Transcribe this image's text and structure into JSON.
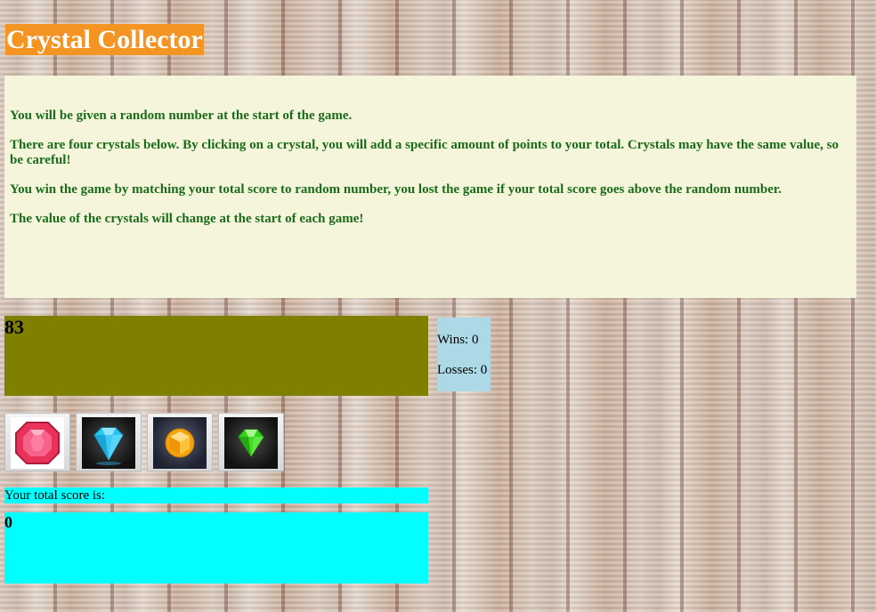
{
  "title": "Crystal Collector",
  "instructions": [
    "You will be given a random number at the start of the game.",
    "There are four crystals below. By clicking on a crystal, you will add a specific amount of points to your total. Crystals may have the same value, so be careful!",
    "You win the game by matching your total score to random number, you lost the game if your total score goes above the random number.",
    "The value of the crystals will change at the start of each game!"
  ],
  "target_number": "83",
  "record": {
    "wins": "Wins: 0",
    "losses": "Losses: 0"
  },
  "crystals": [
    {
      "icon": "red-crystal-icon",
      "color": "#e8325a"
    },
    {
      "icon": "blue-crystal-icon",
      "color": "#29c6f0"
    },
    {
      "icon": "orange-crystal-icon",
      "color": "#f5a20f"
    },
    {
      "icon": "green-crystal-icon",
      "color": "#33d11c"
    }
  ],
  "score_label": "Your total score is:",
  "total_score": "0",
  "colors": {
    "title_bg": "#f39423",
    "instructions_bg": "#f5f5dc",
    "instructions_text": "#1a6b1a",
    "target_bg": "#808000",
    "record_bg": "#add8e6",
    "score_bg": "#00ffff"
  }
}
